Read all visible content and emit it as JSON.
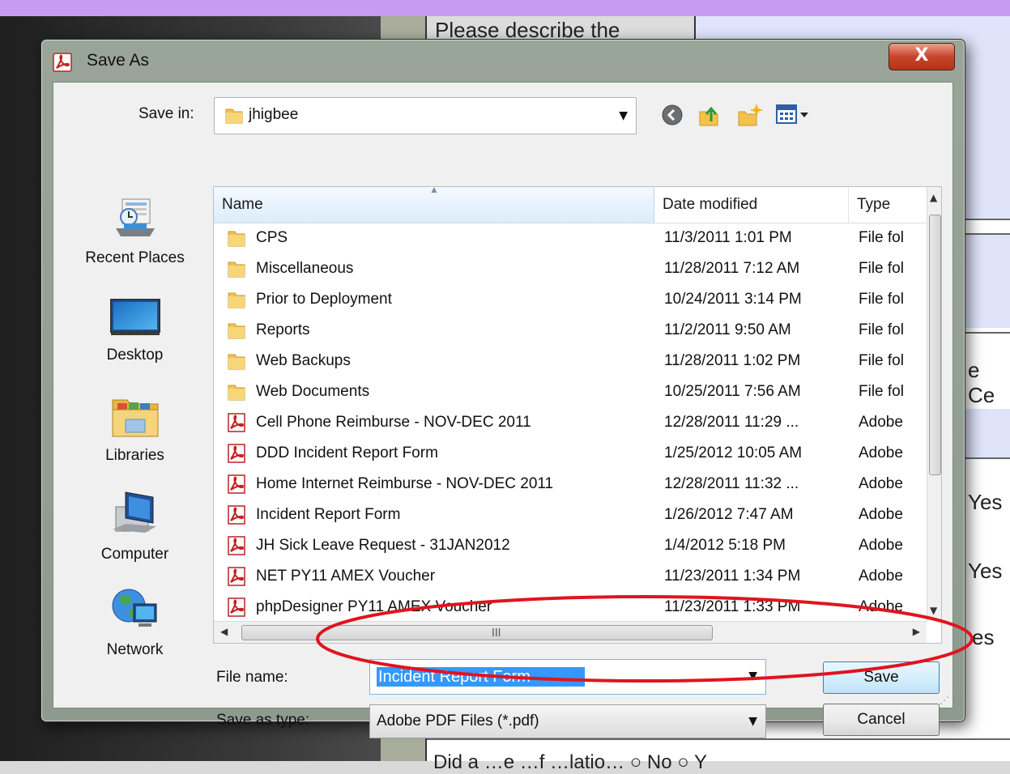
{
  "background": {
    "doc_cell_text": "Please describe the",
    "side_texts": [
      "e Ce",
      "Yes",
      "Yes",
      "es"
    ],
    "bottom_text": "Did a …e …f …latio…  ○ No ○ Y"
  },
  "dialog": {
    "title": "Save As",
    "close_label": "X",
    "save_in": {
      "label": "Save in:",
      "value": "jhigbee"
    },
    "toolbar": {
      "icons": [
        "back-icon",
        "up-folder-icon",
        "new-folder-icon",
        "view-menu-icon"
      ]
    },
    "places": [
      {
        "label": "Recent Places",
        "icon": "recent-places-icon"
      },
      {
        "label": "Desktop",
        "icon": "desktop-icon"
      },
      {
        "label": "Libraries",
        "icon": "libraries-icon"
      },
      {
        "label": "Computer",
        "icon": "computer-icon"
      },
      {
        "label": "Network",
        "icon": "network-icon"
      }
    ],
    "columns": {
      "name": "Name",
      "date": "Date modified",
      "type": "Type"
    },
    "files": [
      {
        "name": "CPS",
        "date": "11/3/2011 1:01 PM",
        "type": "File fol",
        "kind": "folder"
      },
      {
        "name": "Miscellaneous",
        "date": "11/28/2011 7:12 AM",
        "type": "File fol",
        "kind": "folder"
      },
      {
        "name": "Prior to Deployment",
        "date": "10/24/2011 3:14 PM",
        "type": "File fol",
        "kind": "folder"
      },
      {
        "name": "Reports",
        "date": "11/2/2011 9:50 AM",
        "type": "File fol",
        "kind": "folder"
      },
      {
        "name": "Web Backups",
        "date": "11/28/2011 1:02 PM",
        "type": "File fol",
        "kind": "folder"
      },
      {
        "name": "Web Documents",
        "date": "10/25/2011 7:56 AM",
        "type": "File fol",
        "kind": "folder"
      },
      {
        "name": "Cell Phone Reimburse - NOV-DEC 2011",
        "date": "12/28/2011 11:29 ...",
        "type": "Adobe",
        "kind": "pdf"
      },
      {
        "name": "DDD Incident Report Form",
        "date": "1/25/2012 10:05 AM",
        "type": "Adobe",
        "kind": "pdf"
      },
      {
        "name": "Home Internet Reimburse - NOV-DEC 2011",
        "date": "12/28/2011 11:32 ...",
        "type": "Adobe",
        "kind": "pdf"
      },
      {
        "name": "Incident Report Form",
        "date": "1/26/2012 7:47 AM",
        "type": "Adobe",
        "kind": "pdf"
      },
      {
        "name": "JH Sick Leave Request - 31JAN2012",
        "date": "1/4/2012 5:18 PM",
        "type": "Adobe",
        "kind": "pdf"
      },
      {
        "name": "NET PY11 AMEX Voucher",
        "date": "11/23/2011 1:34 PM",
        "type": "Adobe",
        "kind": "pdf"
      },
      {
        "name": "phpDesigner PY11 AMEX Voucher",
        "date": "11/23/2011 1:33 PM",
        "type": "Adobe",
        "kind": "pdf"
      }
    ],
    "file_name": {
      "label": "File name:",
      "value": "Incident Report Form"
    },
    "save_as_type": {
      "label": "Save as type:",
      "value": "Adobe PDF Files (*.pdf)"
    },
    "buttons": {
      "save": "Save",
      "cancel": "Cancel"
    }
  },
  "colors": {
    "annotation": "#e0141e",
    "selection": "#3399ff",
    "pdf_red": "#c41f1f",
    "folder_yellow": "#f2c24d"
  }
}
